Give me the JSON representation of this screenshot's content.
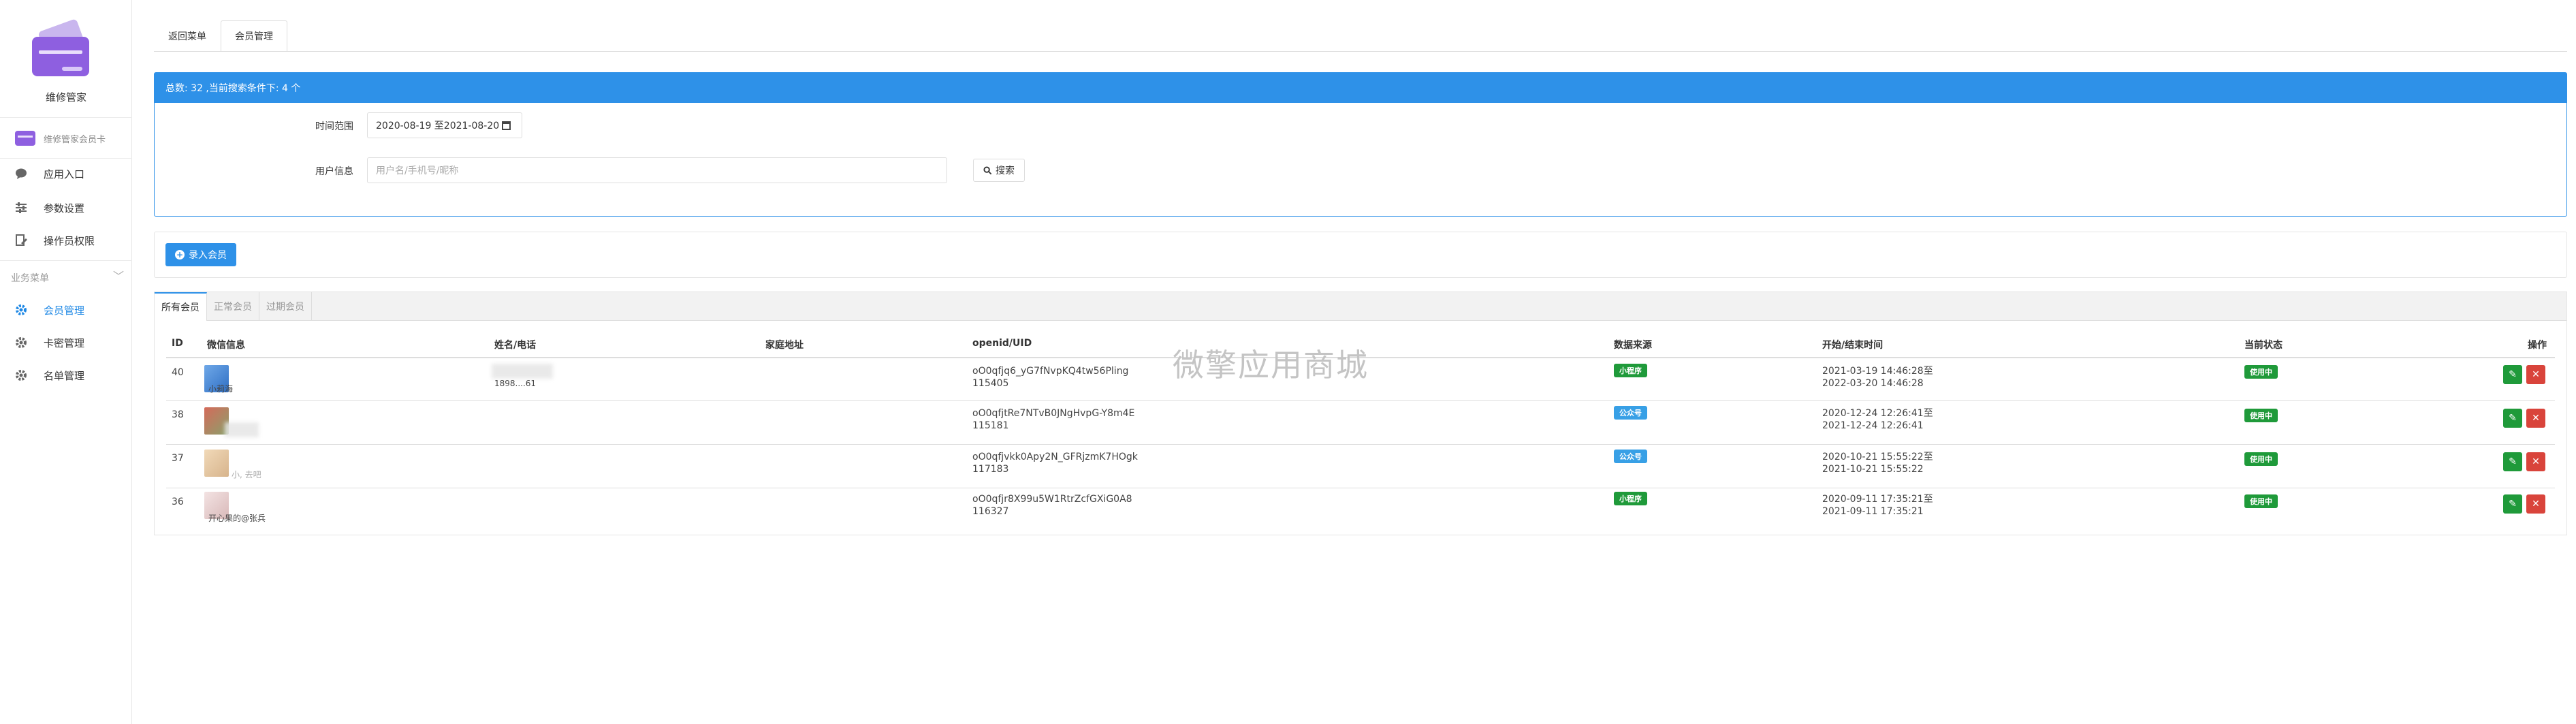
{
  "sidebar": {
    "app_name": "维修管家",
    "card_label": "维修管家会员卡",
    "items": [
      {
        "label": "应用入口",
        "icon": "chat-bubble-icon"
      },
      {
        "label": "参数设置",
        "icon": "sliders-icon"
      },
      {
        "label": "操作员权限",
        "icon": "document-edit-icon"
      }
    ],
    "section_label": "业务菜单",
    "section_items": [
      {
        "label": "会员管理",
        "icon": "gear-icon",
        "active": true
      },
      {
        "label": "卡密管理",
        "icon": "gear-icon"
      },
      {
        "label": "名单管理",
        "icon": "gear-icon"
      }
    ]
  },
  "top_tabs": [
    "返回菜单",
    "会员管理"
  ],
  "filter": {
    "summary": "总数: 32 ,当前搜索条件下: 4 个",
    "time_label": "时间范围",
    "time_value": "2020-08-19 至2021-08-20",
    "user_label": "用户信息",
    "user_placeholder": "用户名/手机号/昵称",
    "search_label": "搜索"
  },
  "add_button": "录入会员",
  "list_tabs": [
    "所有会员",
    "正常会员",
    "过期会员"
  ],
  "table": {
    "headers": [
      "ID",
      "微信信息",
      "姓名/电话",
      "家庭地址",
      "openid/UID",
      "数据来源",
      "开始/结束时间",
      "当前状态",
      "操作"
    ],
    "rows": [
      {
        "id": "40",
        "wx": "小莉海",
        "phone": "1898....61",
        "openid": "oO0qfjq6_yG7fNvpKQ4tw56Pling",
        "uid": "115405",
        "source": "小程序",
        "source_color": "#1f9a3a",
        "start": "2021-03-19 14:46:28至",
        "end": "2022-03-20 14:46:28",
        "status": "使用中"
      },
      {
        "id": "38",
        "wx": "",
        "phone": "",
        "openid": "oO0qfjtRe7NTvB0JNgHvpG-Y8m4E",
        "uid": "115181",
        "source": "公众号",
        "source_color": "#38a0e6",
        "start": "2020-12-24 12:26:41至",
        "end": "2021-12-24 12:26:41",
        "status": "使用中"
      },
      {
        "id": "37",
        "wx": "小, 去吧",
        "phone": "",
        "openid": "oO0qfjvkk0Apy2N_GFRjzmK7HOgk",
        "uid": "117183",
        "source": "公众号",
        "source_color": "#38a0e6",
        "start": "2020-10-21 15:55:22至",
        "end": "2021-10-21 15:55:22",
        "status": "使用中"
      },
      {
        "id": "36",
        "wx": "开心果的@张兵",
        "phone": "",
        "openid": "oO0qfjr8X99u5W1RtrZcfGXiG0A8",
        "uid": "116327",
        "source": "小程序",
        "source_color": "#1f9a3a",
        "start": "2020-09-11 17:35:21至",
        "end": "2021-09-11 17:35:21",
        "status": "使用中"
      }
    ],
    "edit_icon": "edit-icon",
    "delete_icon": "close-icon"
  },
  "watermark": "微擎应用商城"
}
